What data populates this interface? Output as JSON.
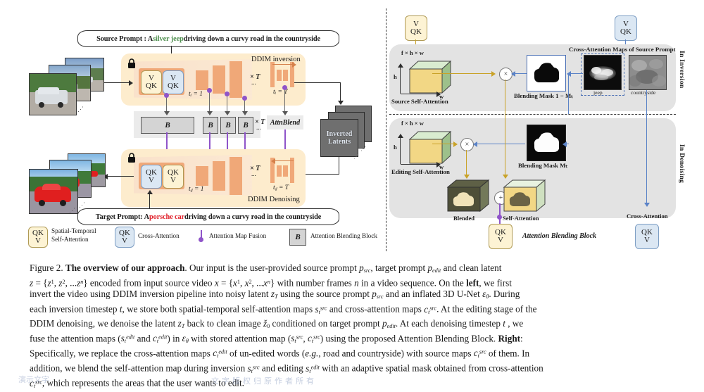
{
  "figure": {
    "label": "Figure 2.",
    "title": "The overview of our approach",
    "caption_lines": [
      "Figure 2. The overview of our approach. Our input is the user-provided source prompt p_src, target prompt p_edit and clean latent",
      "z = {z1, z2, ...zn} encoded from input source video x = {x1, x2, ...xn} with number frames n in a video sequence. On the left, we first",
      "invert the video using DDIM inversion pipeline into noisy latent z_T using the source prompt p_src and an inflated 3D U-Net e_theta. During",
      "each inversion timestep t, we store both spatial-temporal self-attention maps s_t^src and cross-attention maps c_t^src. At the editing stage of the",
      "DDIM denoising, we denoise the latent z_T back to clean image z0_hat conditioned on target prompt p_edit. At each denoising timestep t , we",
      "fuse the attention maps (s_t^edit and c_t^edit) in e_theta with stored attention map (s_t^src, c_t^src) using the proposed Attention Blending Block. Right:",
      "Specifically, we replace the cross-attention maps c_t^edit of un-edited words (e.g., road and countryside) with source maps c_t^src of them. In",
      "addition, we blend the self-attention map during inversion s_t^src and editing s_t^edit with an adaptive spatial mask obtained from cross-attention",
      "c_t^src, which represents the areas that the user wants to edit."
    ]
  },
  "left_panel": {
    "source_prompt": {
      "prefix": "Source Prompt : A ",
      "highlight": "silver jeep",
      "highlight_color": "#4f8f4f",
      "suffix": " driving down a curvy road in the countryside"
    },
    "target_prompt": {
      "prefix": "Target Prompt: A ",
      "highlight": "porsche car",
      "highlight_color": "#e0202a",
      "suffix": " driving down a curvy road in the countryside"
    },
    "inversion_title": "DDIM inversion",
    "denoising_title": "DDIM Denoising",
    "inversion_step_start": "tᵢ = 1",
    "inversion_step_end": "tᵢ = T",
    "denoise_step_start": "t_d = 1",
    "denoise_step_end": "t_d = T",
    "times_T": "× T",
    "ellipsis": "...",
    "attn_blend_label": "AttnBlend",
    "inverted_latents": [
      "Inverted",
      "Latents"
    ],
    "self_attn_box": {
      "top": "V",
      "bottom": "QK"
    },
    "cross_attn_box": {
      "top": "V",
      "bottom": "QK"
    },
    "denoise_self_attn_box": {
      "top": "QK",
      "bottom": "V"
    },
    "denoise_cross_attn_box": {
      "top": "QK",
      "bottom": "V"
    },
    "b_label": "B",
    "lock_icon": "lock-icon"
  },
  "legend": [
    {
      "icon_top": "QK",
      "icon_bottom": "V",
      "style": "yellow",
      "label_line1": "Spatial-Temporal",
      "label_line2": "Self-Attention"
    },
    {
      "icon_top": "QK",
      "icon_bottom": "V",
      "style": "blue",
      "label_line1": "Cross-Attention",
      "label_line2": ""
    },
    {
      "icon": "attention-map-fusion-marker",
      "label_line1": "Attention Map Fusion",
      "label_line2": ""
    },
    {
      "icon": "B",
      "style": "grey",
      "label_line1": "Attention Blending Block",
      "label_line2": ""
    }
  ],
  "right_panel": {
    "inversion": {
      "side_label": "In Inversion",
      "cube_dims": "f × h × w",
      "axis_h": "h",
      "axis_w": "w",
      "cube_caption": "Source Self-Attention",
      "mask_caption": "Blending Mask 1 − Mₜ",
      "cross_attn_title": "Cross-Attention Maps of Source Prompt",
      "attn_maps": [
        {
          "caption": "jeep",
          "selected": true
        },
        {
          "caption": "countryside",
          "selected": false
        }
      ],
      "qkv_self": {
        "top": "V",
        "bottom": "QK",
        "style": "yellow"
      },
      "qkv_cross": {
        "top": "V",
        "bottom": "QK",
        "style": "blue"
      },
      "multiply_symbol": "×"
    },
    "denoising": {
      "side_label": "In Denoising",
      "cube_dims": "f × h × w",
      "axis_h": "h",
      "axis_w": "w",
      "cube_caption": "Editing Self-Attention",
      "mask_caption": "Blending Mask Mₜ",
      "blended_caption": "Blended",
      "selfattn_caption": "Self-Attention",
      "cross_attn_caption": "Cross-Attention",
      "block_title": "Attention Blending Block",
      "qkv_out": {
        "top": "QK",
        "bottom": "V",
        "style": "yellow"
      },
      "qkv_cross_out": {
        "top": "QK",
        "bottom": "V",
        "style": "blue"
      },
      "multiply_symbol": "×",
      "plus_symbol": "+"
    }
  },
  "watermarks": {
    "left": "演示文字",
    "right": "文字版权归原作者所有"
  },
  "colors": {
    "self_attn_fill": "#fdf3d4",
    "self_attn_stroke": "#b09a55",
    "cross_attn_fill": "#dbe7f3",
    "cross_attn_stroke": "#7d9ec4",
    "unet_block": "#f0a878",
    "panel_bg": "#fdeccd",
    "fusion_dot": "#8f54c9",
    "right_panel_bg": "#e3e3e3",
    "mask_border": "#4a6fb5",
    "arrow_yellow": "#c9a227",
    "arrow_blue": "#5b83c7"
  }
}
